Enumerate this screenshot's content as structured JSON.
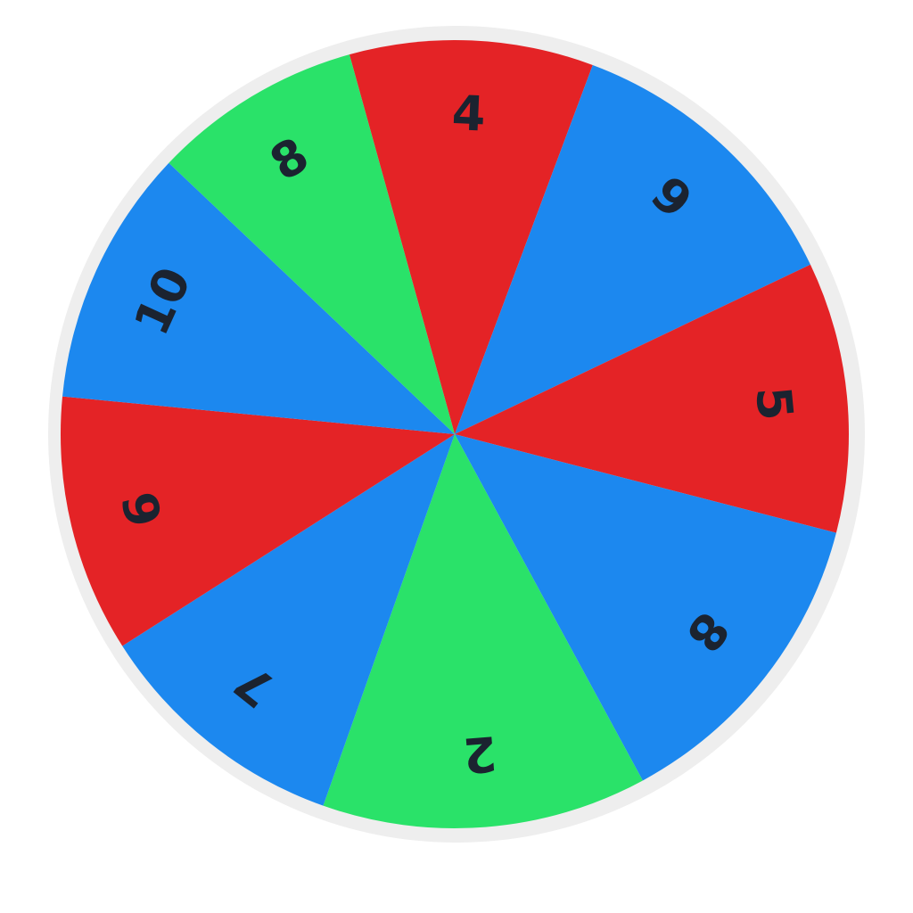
{
  "wheel": {
    "rim_color": "#eeeeee",
    "segments": [
      {
        "label": "4",
        "color": "#e42326",
        "color_name": "red"
      },
      {
        "label": "9",
        "color": "#1c88ef",
        "color_name": "blue"
      },
      {
        "label": "5",
        "color": "#e42326",
        "color_name": "red"
      },
      {
        "label": "8",
        "color": "#1c88ef",
        "color_name": "blue"
      },
      {
        "label": "2",
        "color": "#2ae269",
        "color_name": "green"
      },
      {
        "label": "7",
        "color": "#1c88ef",
        "color_name": "blue"
      },
      {
        "label": "6",
        "color": "#e42326",
        "color_name": "red"
      },
      {
        "label": "10",
        "color": "#1c88ef",
        "color_name": "blue"
      },
      {
        "label": "8",
        "color": "#2ae269",
        "color_name": "green"
      }
    ]
  }
}
